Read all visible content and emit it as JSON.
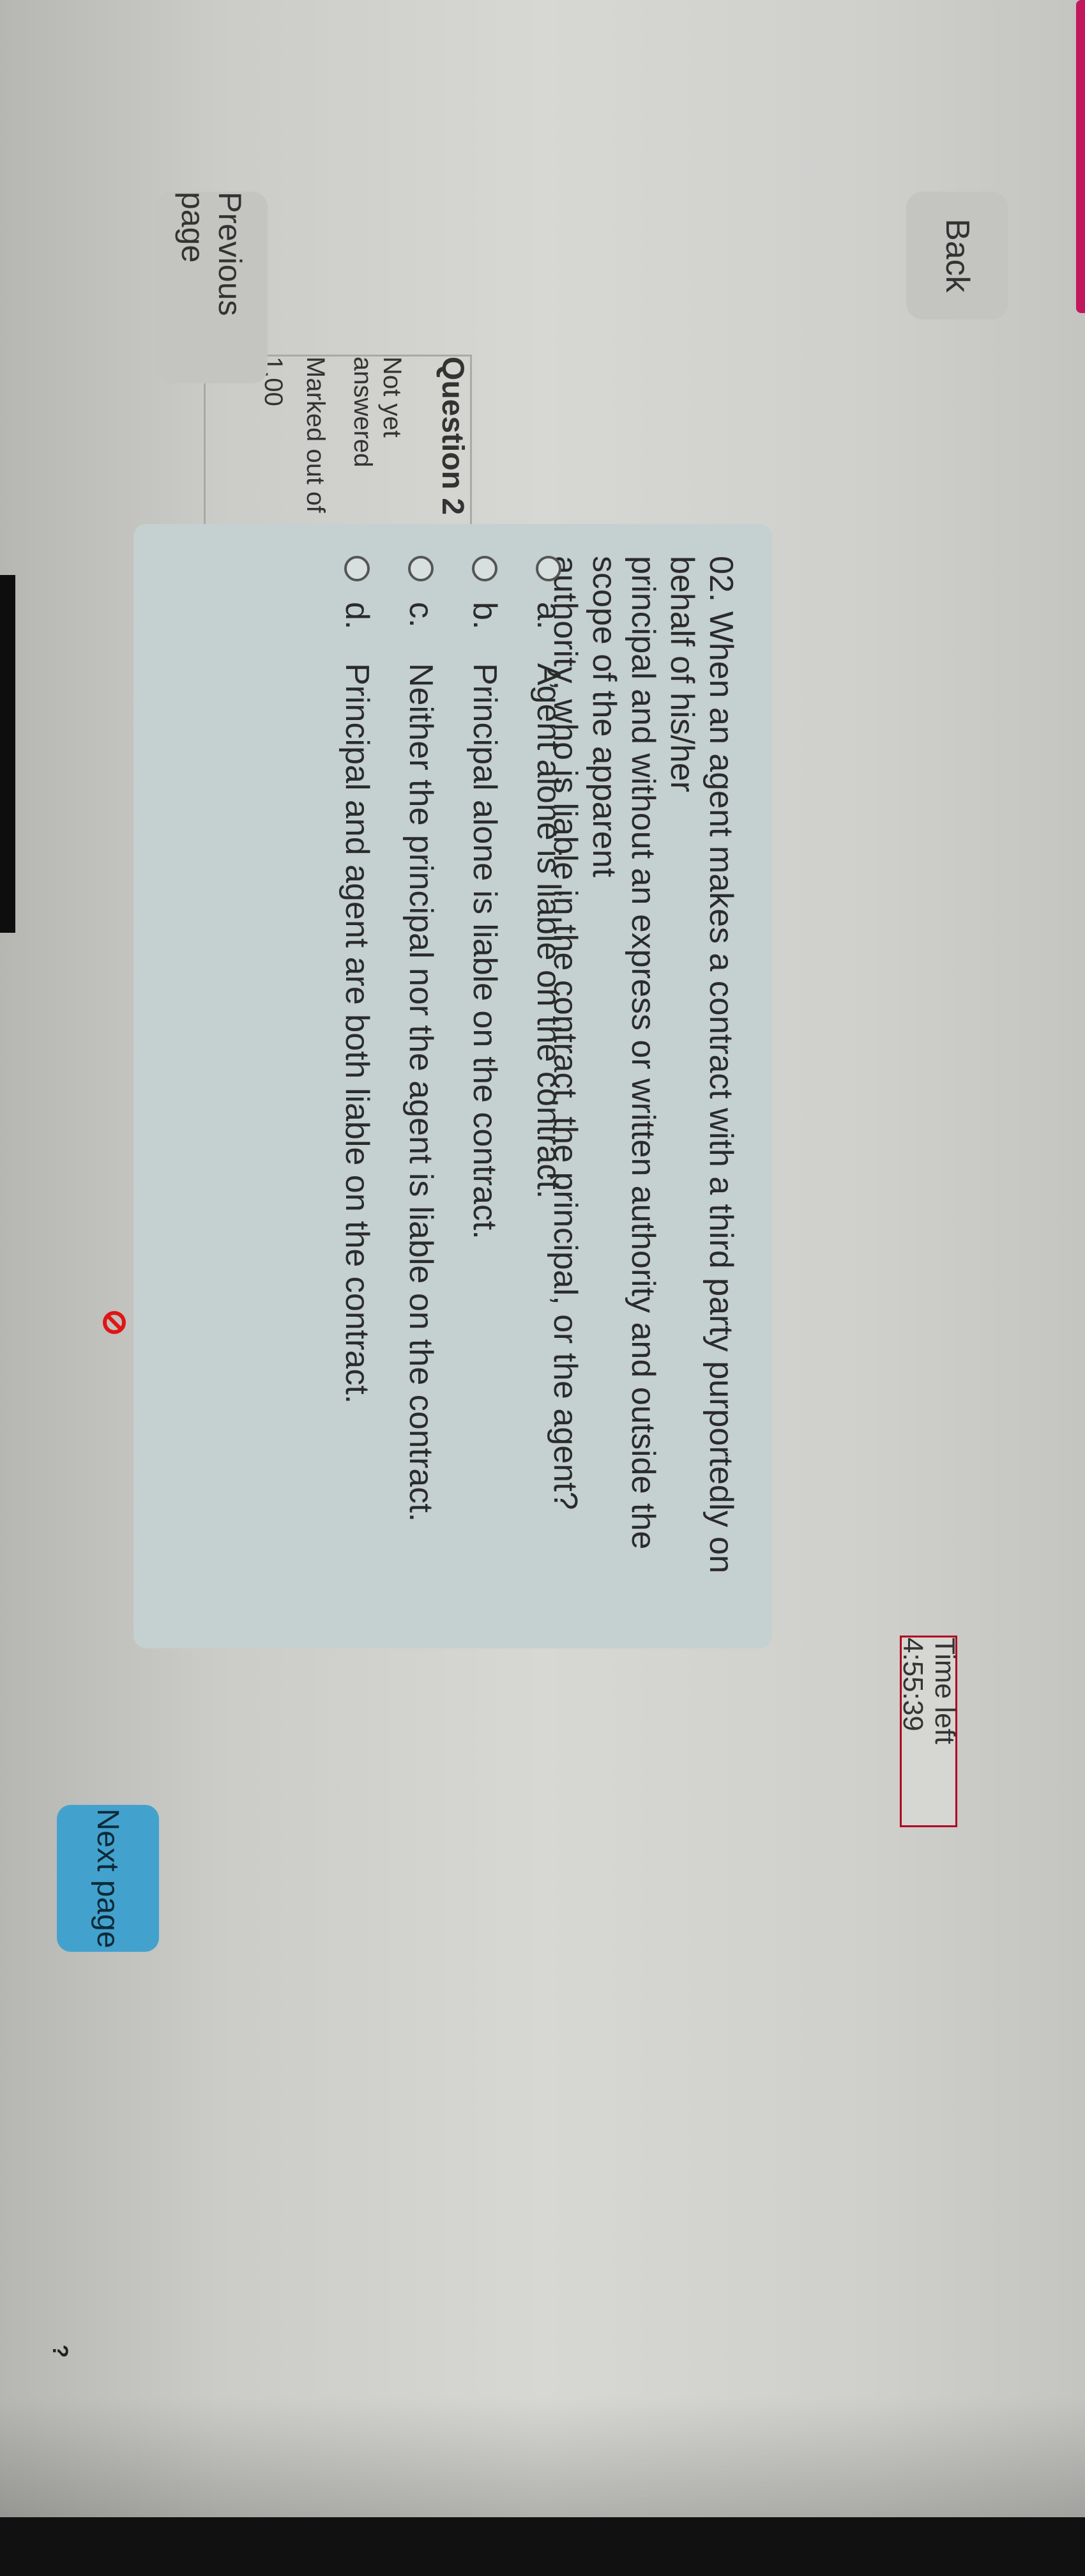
{
  "nav": {
    "back_label": "Back",
    "previous_label": "Previous page",
    "next_label": "Next page",
    "help_label": "?"
  },
  "timer": {
    "text": "Time left 4:55:39"
  },
  "question_info": {
    "title": "Question 2",
    "status_line1": "Not yet",
    "status_line2": "answered",
    "marked_label": "Marked out of",
    "marked_value": "1.00"
  },
  "question": {
    "text_line1": "02. When an agent makes a contract with a third party purportedly on behalf of his/her",
    "text_line2": "principal and without an express or written authority and outside the scope of the apparent",
    "text_line3": "authority, who is liable in the contract, the principal, or the agent?",
    "options": [
      {
        "letter": "a.",
        "text": "Agent alone is liable on the contract."
      },
      {
        "letter": "b.",
        "text": "Principal alone is liable on the contract."
      },
      {
        "letter": "c.",
        "text": "Neither the principal nor the agent is liable on the contract."
      },
      {
        "letter": "d.",
        "text": "Principal and agent are both liable on the contract."
      }
    ]
  },
  "colors": {
    "accent_pink": "#c2185b",
    "next_button": "#43a2cd",
    "timer_border": "#b00020",
    "question_bg": "#c5d0d0"
  }
}
